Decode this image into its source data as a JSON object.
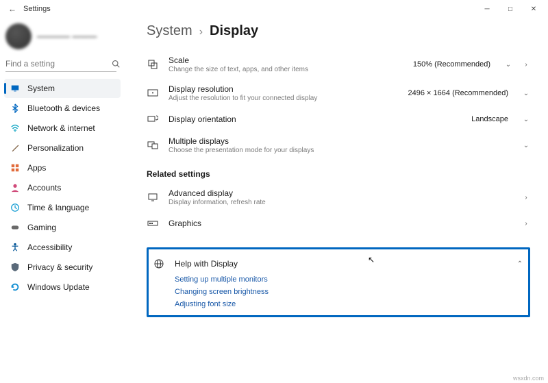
{
  "window": {
    "title": "Settings"
  },
  "search": {
    "placeholder": "Find a setting"
  },
  "sidebar": {
    "items": [
      {
        "label": "System",
        "icon": "display-icon",
        "color": "#0067c0"
      },
      {
        "label": "Bluetooth & devices",
        "icon": "bluetooth-icon",
        "color": "#0067c0"
      },
      {
        "label": "Network & internet",
        "icon": "wifi-icon",
        "color": "#0aa3c2"
      },
      {
        "label": "Personalization",
        "icon": "brush-icon",
        "color": "#7a5c3e"
      },
      {
        "label": "Apps",
        "icon": "apps-icon",
        "color": "#e16b3b"
      },
      {
        "label": "Accounts",
        "icon": "person-icon",
        "color": "#d04a7a"
      },
      {
        "label": "Time & language",
        "icon": "clock-icon",
        "color": "#1a9fd4"
      },
      {
        "label": "Gaming",
        "icon": "gamepad-icon",
        "color": "#6a6a6a"
      },
      {
        "label": "Accessibility",
        "icon": "accessibility-icon",
        "color": "#0a5a9a"
      },
      {
        "label": "Privacy & security",
        "icon": "shield-icon",
        "color": "#5a6a7a"
      },
      {
        "label": "Windows Update",
        "icon": "update-icon",
        "color": "#0a8ad0"
      }
    ]
  },
  "breadcrumb": {
    "parent": "System",
    "sep": "›",
    "current": "Display"
  },
  "rows": {
    "scale": {
      "title": "Scale",
      "sub": "Change the size of text, apps, and other items",
      "value": "150% (Recommended)"
    },
    "res": {
      "title": "Display resolution",
      "sub": "Adjust the resolution to fit your connected display",
      "value": "2496 × 1664 (Recommended)"
    },
    "orient": {
      "title": "Display orientation",
      "value": "Landscape"
    },
    "multi": {
      "title": "Multiple displays",
      "sub": "Choose the presentation mode for your displays"
    },
    "related_hdr": "Related settings",
    "advdisp": {
      "title": "Advanced display",
      "sub": "Display information, refresh rate"
    },
    "graphics": {
      "title": "Graphics"
    }
  },
  "help": {
    "title": "Help with Display",
    "links": [
      "Setting up multiple monitors",
      "Changing screen brightness",
      "Adjusting font size"
    ]
  },
  "footer_note": "wsxdn.com"
}
